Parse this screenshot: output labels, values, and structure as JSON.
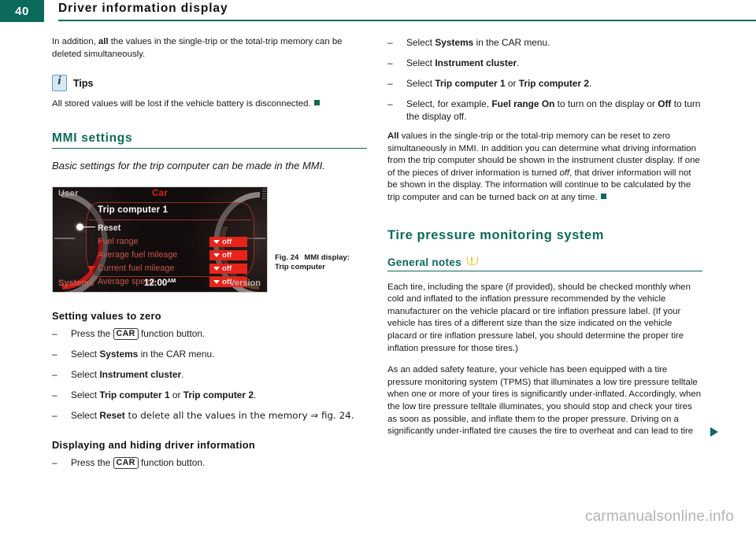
{
  "header": {
    "page_number": "40",
    "title": "Driver information display",
    "accent_color": "#0b6a5c"
  },
  "left_column": {
    "intro": {
      "part1": "In addition, ",
      "bold": "all",
      "part2": " the values in the single-trip or the total-trip memory can be deleted simultaneously."
    },
    "tips": {
      "icon": "info-icon",
      "label": "Tips",
      "text": "All stored values will be lost if the vehicle battery is disconnected."
    },
    "mmi_settings": {
      "heading": "MMI settings",
      "intro_italic": "Basic settings for the trip computer can be made in the MMI."
    },
    "figure": {
      "caption_number": "Fig. 24",
      "caption_line1": "MMI display:",
      "caption_line2": "Trip computer",
      "mmi": {
        "top_left": "User",
        "top_center": "Car",
        "panel_title": "Trip computer 1",
        "rows": [
          {
            "label": "Reset",
            "value": "",
            "selected": true
          },
          {
            "label": "Fuel range",
            "value": "off",
            "selected": false
          },
          {
            "label": "Average fuel mileage",
            "value": "off",
            "selected": false
          },
          {
            "label": "Current fuel mileage",
            "value": "off",
            "selected": false
          },
          {
            "label": "Average speed",
            "value": "off",
            "selected": false
          }
        ],
        "bottom_left": "Systems",
        "clock": "12:00",
        "clock_meridiem": "AM",
        "bottom_right": "Version"
      }
    },
    "setting_values": {
      "heading": "Setting values to zero",
      "steps": [
        {
          "pre": "Press the ",
          "key": "CAR",
          "post": " function button."
        },
        {
          "pre": "Select ",
          "bold": "Systems",
          "post": " in the CAR menu."
        },
        {
          "pre": "Select ",
          "bold": "Instrument cluster",
          "post": "."
        },
        {
          "pre": "Select ",
          "bold": "Trip computer 1",
          "mid": " or ",
          "bold2": "Trip computer 2",
          "post": "."
        },
        {
          "pre": "Select ",
          "bold": "Reset",
          "post": " to delete all the values in the memory ⇒ fig. 24."
        }
      ]
    },
    "displaying_hiding": {
      "heading": "Displaying and hiding driver information",
      "step": {
        "pre": "Press the ",
        "key": "CAR",
        "post": " function button."
      }
    }
  },
  "right_column": {
    "steps": [
      {
        "pre": "Select ",
        "bold": "Systems",
        "post": " in the CAR menu."
      },
      {
        "pre": "Select ",
        "bold": "Instrument cluster",
        "post": "."
      },
      {
        "pre": "Select ",
        "bold": "Trip computer 1",
        "mid": " or ",
        "bold2": "Trip computer 2",
        "post": "."
      },
      {
        "pre": "Select, for example, ",
        "bold": "Fuel range On",
        "mid": " to turn on the display or ",
        "bold2": "Off",
        "post": " to turn the display off."
      }
    ],
    "paragraph_all": {
      "bold_lead": "All",
      "text": " values in the single-trip or the total-trip memory can be reset to zero simultaneously in MMI. In addition you can determine what driving information from the trip computer should be shown in the instrument cluster display. If one of the pieces of driver information is turned ",
      "italic1": "off",
      "text2": ", that driver information will not be shown in the display. The information will continue to be calculated by the trip computer and can be turned back ",
      "italic2": "on",
      "text3": " at any time."
    },
    "tpms": {
      "heading": "Tire pressure monitoring system",
      "subheading": "General notes",
      "subheading_icon": "tpms-warning-icon",
      "paragraph1": "Each tire, including the spare (if provided), should be checked monthly when cold and inflated to the inflation pressure recommended by the vehicle manufacturer on the vehicle placard or tire inflation pressure label. (If your vehicle has tires of a different size than the size indicated on the vehicle placard or tire inflation pressure label, you should determine the proper tire inflation pressure for those tires.)",
      "paragraph2": "As an added safety feature, your vehicle has been equipped with a tire pressure monitoring system (TPMS) that illuminates a low tire pressure telltale when one or more of your tires is significantly under-inflated. Accordingly, when the low tire pressure telltale illuminates, you should stop and check your tires as soon as possible, and inflate them to the proper pressure. Driving on a significantly under-inflated tire causes the tire to overheat and can lead to tire"
    }
  },
  "watermark": "carmanualsonline.info"
}
